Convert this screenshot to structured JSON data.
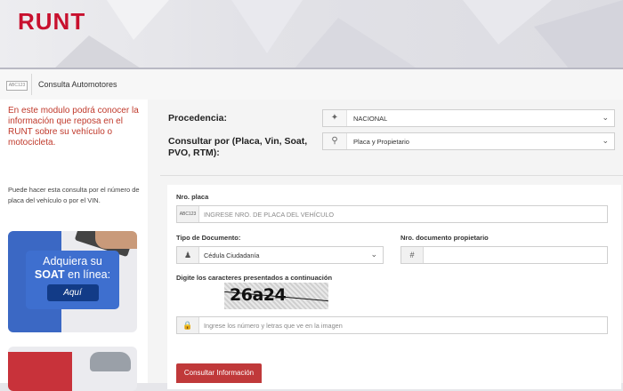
{
  "brand": {
    "logo": "RUNT",
    "accent": "#c8102e"
  },
  "nav": {
    "icon_text": "ABC123",
    "title": "Consulta Automotores"
  },
  "sidebar": {
    "intro": "En este modulo podrá conocer la información que reposa en el RUNT sobre su vehículo o motocicleta.",
    "note": "Puede hacer esta consulta por el número de placa del vehículo o por el VIN.",
    "soat_banner": {
      "line1": "Adquiera su",
      "line2_bold": "SOAT",
      "line2_rest": " en línea:",
      "button": "Aquí"
    }
  },
  "form": {
    "procedencia": {
      "label": "Procedencia:",
      "value": "NACIONAL",
      "icon": "map-icon"
    },
    "consultar_por": {
      "label": "Consultar por (Placa, Vin, Soat, PVO, RTM):",
      "value": "Placa y Propietario",
      "icon": "search-user-icon"
    },
    "placa": {
      "label": "Nro. placa",
      "placeholder": "INGRESE NRO. DE PLACA DEL VEHÍCULO",
      "icon_text": "ABC123"
    },
    "tipo_documento": {
      "label": "Tipo de Documento:",
      "value": "Cédula Ciudadanía",
      "icon": "user-icon"
    },
    "nro_documento": {
      "label": "Nro. documento propietario",
      "icon": "#"
    },
    "captcha": {
      "label": "Digite los caracteres presentados a continuación",
      "image_text": "26a24",
      "placeholder": "Ingrese los número y letras que ve en la imagen",
      "icon": "lock-icon"
    },
    "submit": "Consultar Información"
  }
}
